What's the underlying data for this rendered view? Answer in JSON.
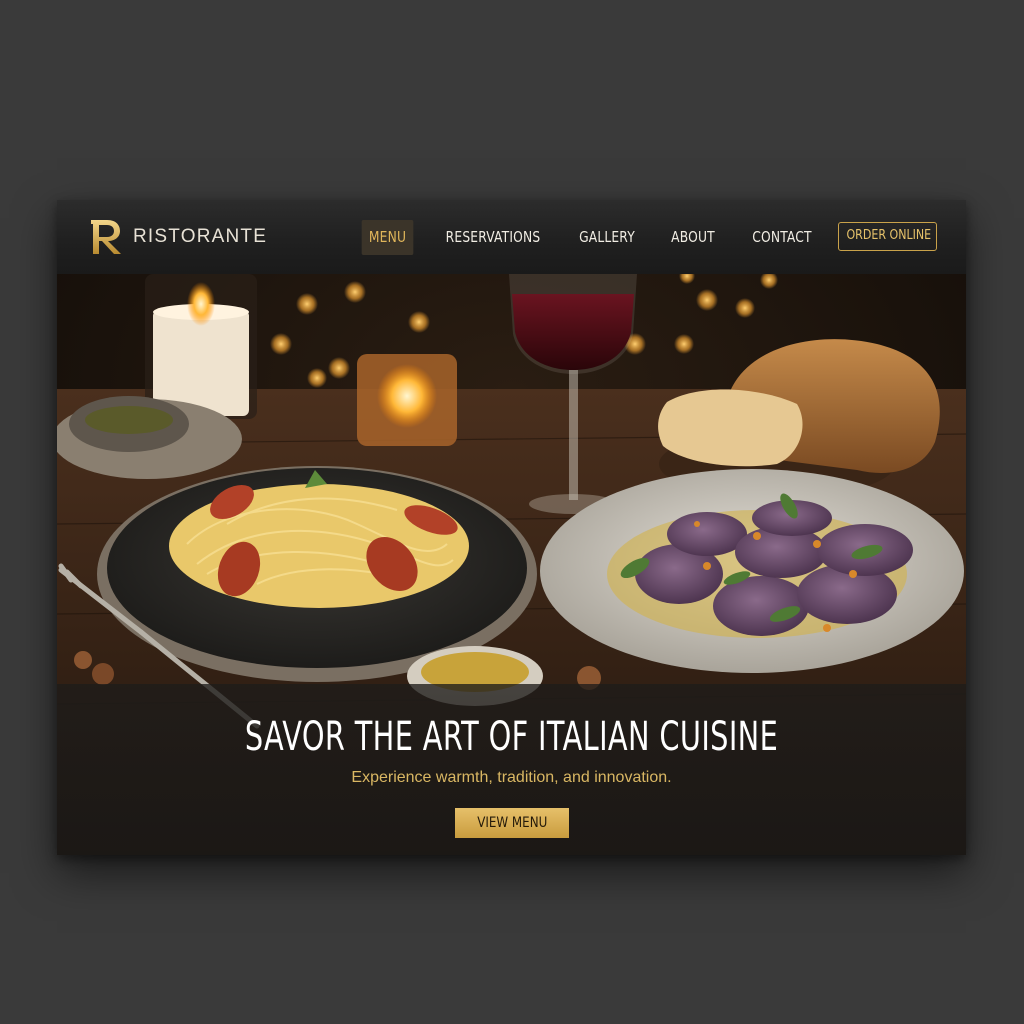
{
  "brand": {
    "initial": "R",
    "name": "RISTORANTE"
  },
  "nav": {
    "items": [
      {
        "label": "MENU",
        "active": true
      },
      {
        "label": "RESERVATIONS",
        "active": false
      },
      {
        "label": "GALLERY",
        "active": false
      },
      {
        "label": "ABOUT",
        "active": false
      },
      {
        "label": "CONTACT",
        "active": false
      }
    ],
    "order_label": "ORDER ONLINE"
  },
  "hero": {
    "headline": "SAVOR THE ART OF ITALIAN CUISINE",
    "subline": "Experience warmth, tradition, and innovation.",
    "cta_label": "VIEW MENU"
  },
  "colors": {
    "accent_gold": "#c9a24a",
    "nav_bg": "#222222",
    "page_bg": "#3a3a3a"
  }
}
